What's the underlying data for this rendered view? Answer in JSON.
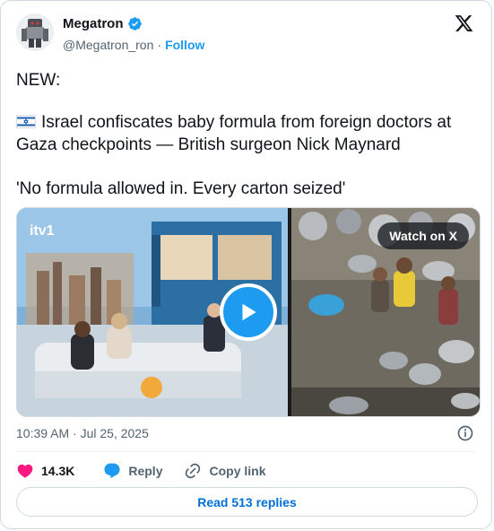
{
  "author": {
    "name": "Megatron",
    "handle": "@Megatron_ron",
    "separator": "·",
    "follow_label": "Follow"
  },
  "post": {
    "line1": "NEW:",
    "line2a": "Israel confiscates baby formula from foreign doctors at",
    "line2b": "Gaza checkpoints — British surgeon Nick Maynard",
    "line3": "'No formula allowed in. Every carton seized'"
  },
  "media": {
    "watch_label": "Watch on X",
    "tv_logo": "itv1"
  },
  "timestamp": "10:39 AM · Jul 25, 2025",
  "actions": {
    "likes": "14.3K",
    "reply_label": "Reply",
    "copy_label": "Copy link"
  },
  "read_replies_label": "Read 513 replies",
  "colors": {
    "accent": "#1d9bf0",
    "like": "#f91880",
    "link": "#006fd6",
    "secondary_text": "#536471"
  },
  "icons": [
    "verified-badge-icon",
    "x-logo-icon",
    "israel-flag-icon",
    "play-icon",
    "info-icon",
    "heart-icon",
    "reply-bubble-icon",
    "link-icon"
  ]
}
